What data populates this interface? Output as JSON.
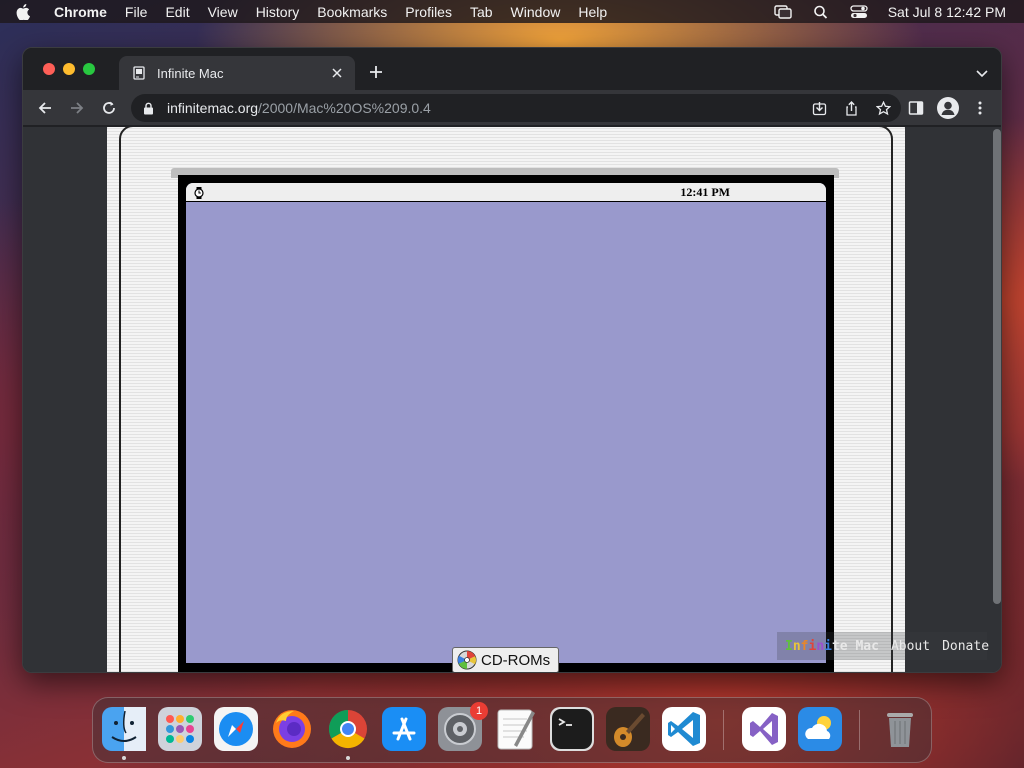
{
  "menubar": {
    "app_name": "Chrome",
    "menus": [
      "File",
      "Edit",
      "View",
      "History",
      "Bookmarks",
      "Profiles",
      "Tab",
      "Window",
      "Help"
    ],
    "clock": "Sat Jul 8  12:42 PM"
  },
  "browser": {
    "tab_title": "Infinite Mac",
    "url_domain": "infinitemac.org",
    "url_path": "/2000/Mac%20OS%209.0.4"
  },
  "emulator": {
    "clock": "12:41 PM",
    "cdroms_label": "CD-ROMs",
    "desktop_color": "#9999cc"
  },
  "footer": {
    "logo_letters": [
      {
        "ch": "I",
        "color": "#5fbf3f"
      },
      {
        "ch": "n",
        "color": "#e8c53a"
      },
      {
        "ch": "f",
        "color": "#e8862a"
      },
      {
        "ch": "i",
        "color": "#e0443a"
      },
      {
        "ch": "n",
        "color": "#9b4fd0"
      },
      {
        "ch": "i",
        "color": "#3a7fe0"
      },
      {
        "ch": "t",
        "color": "#e8e8e8"
      },
      {
        "ch": "e",
        "color": "#e8e8e8"
      }
    ],
    "logo_rest": "Mac",
    "links": [
      "About",
      "Donate"
    ]
  },
  "dock": {
    "apps": [
      "finder",
      "launchpad",
      "safari",
      "firefox",
      "chrome",
      "app-store",
      "system-settings",
      "textedit",
      "terminal",
      "garageband",
      "vscode",
      "visual-studio",
      "weather",
      "trash"
    ],
    "settings_badge": "1"
  }
}
